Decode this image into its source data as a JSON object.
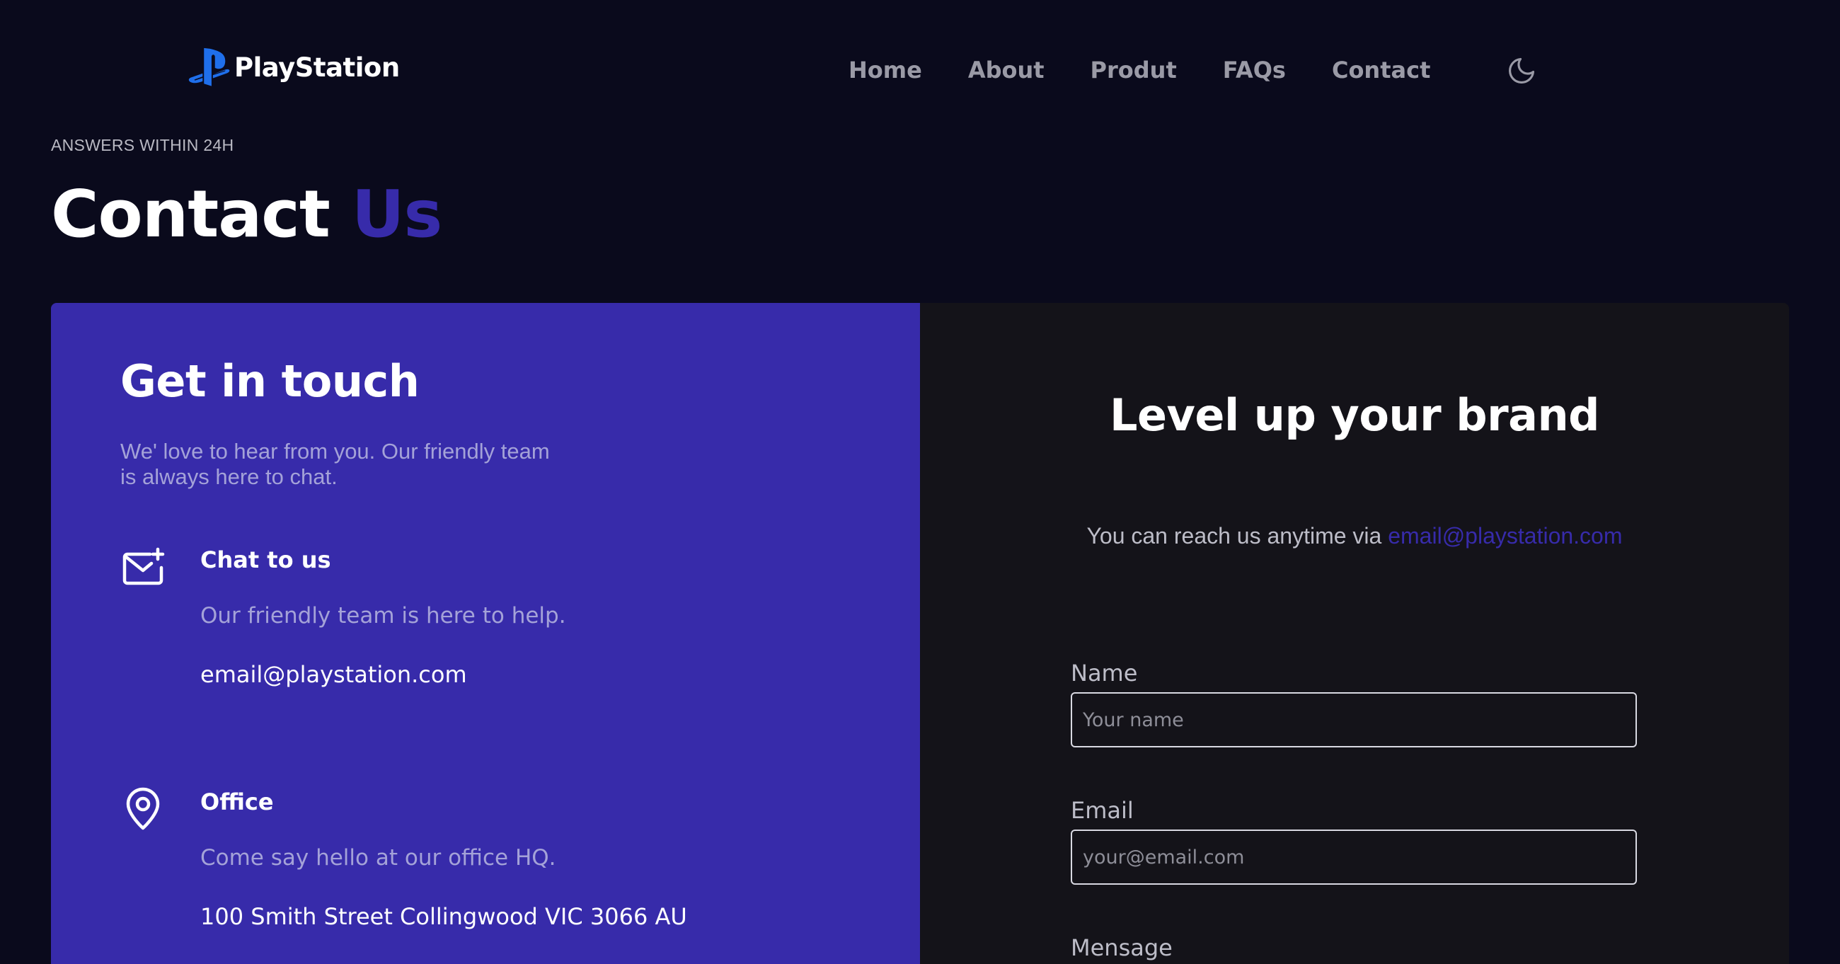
{
  "brand": {
    "name": "PlayStation",
    "logo_icon": "playstation-logo-icon",
    "accent_color": "#372baa"
  },
  "nav": {
    "items": [
      {
        "label": "Home"
      },
      {
        "label": "About"
      },
      {
        "label": "Produt"
      },
      {
        "label": "FAQs"
      },
      {
        "label": "Contact"
      }
    ],
    "theme_toggle_icon": "moon-icon"
  },
  "hero": {
    "eyebrow": "ANSWERS WITHIN 24H",
    "title_main": "Contact",
    "title_accent": "Us"
  },
  "info_panel": {
    "background_color": "#372baa",
    "title": "Get in touch",
    "intro_line1": "We' love to hear from you. Our friendly team",
    "intro_line2": "is always here to chat.",
    "items": [
      {
        "icon": "mail-plus-icon",
        "title": "Chat to us",
        "description": "Our friendly team is here to help.",
        "value": "email@playstation.com"
      },
      {
        "icon": "location-pin-icon",
        "title": "Office",
        "description": "Come say hello at our office HQ.",
        "value": "100 Smith Street Collingwood VIC 3066 AU"
      }
    ]
  },
  "form_panel": {
    "background_color": "#141319",
    "title": "Level up your brand",
    "reach_text": "You can reach us anytime via ",
    "reach_email": "email@playstation.com",
    "fields": [
      {
        "label": "Name",
        "placeholder": "Your name",
        "value": ""
      },
      {
        "label": "Email",
        "placeholder": "your@email.com",
        "value": ""
      },
      {
        "label": "Mensage"
      }
    ]
  }
}
